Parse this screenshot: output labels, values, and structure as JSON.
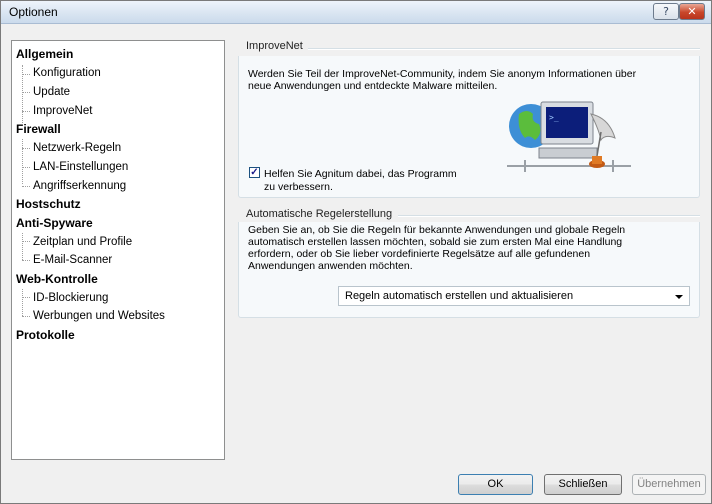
{
  "window": {
    "title": "Optionen",
    "help_label": "?",
    "close_label": "✕"
  },
  "tree": [
    {
      "label": "Allgemein",
      "level": 0
    },
    {
      "label": "Konfiguration",
      "level": 1
    },
    {
      "label": "Update",
      "level": 1
    },
    {
      "label": "ImproveNet",
      "level": 1,
      "selected": true
    },
    {
      "label": "Firewall",
      "level": 0
    },
    {
      "label": "Netzwerk-Regeln",
      "level": 1
    },
    {
      "label": "LAN-Einstellungen",
      "level": 1
    },
    {
      "label": "Angriffserkennung",
      "level": 1
    },
    {
      "label": "Hostschutz",
      "level": 0
    },
    {
      "label": "Anti-Spyware",
      "level": 0
    },
    {
      "label": "Zeitplan und Profile",
      "level": 1
    },
    {
      "label": "E-Mail-Scanner",
      "level": 1
    },
    {
      "label": "Web-Kontrolle",
      "level": 0
    },
    {
      "label": "ID-Blockierung",
      "level": 1
    },
    {
      "label": "Werbungen und Websites",
      "level": 1
    },
    {
      "label": "Protokolle",
      "level": 0
    }
  ],
  "improvenet": {
    "title": "ImproveNet",
    "desc_line1": "Werden Sie Teil der ImproveNet-Community, indem Sie anonym Informationen über",
    "desc_line2": "neue Anwendungen und entdeckte Malware mitteilen.",
    "checkbox_checked": true,
    "checkbox_mark": "✓",
    "checkbox_line1": "Helfen Sie Agnitum dabei, das Programm",
    "checkbox_line2": "zu verbessern."
  },
  "auto_rules": {
    "title": "Automatische Regelerstellung",
    "line1": "Geben Sie an, ob Sie die Regeln für bekannte Anwendungen und globale Regeln",
    "line2": "automatisch erstellen lassen möchten, sobald sie zum ersten Mal eine Handlung",
    "line3": "erfordern, oder ob Sie lieber vordefinierte Regelsätze auf alle gefundenen",
    "line4": "Anwendungen anwenden möchten.",
    "dropdown_value": "Regeln automatisch erstellen und aktualisieren"
  },
  "buttons": {
    "ok": "OK",
    "close": "Schließen",
    "apply": "Übernehmen"
  },
  "icons": {
    "help": "help-icon",
    "close": "close-icon",
    "illustration": "globe-computer-quill-icon",
    "dropdown": "chevron-down-icon"
  }
}
